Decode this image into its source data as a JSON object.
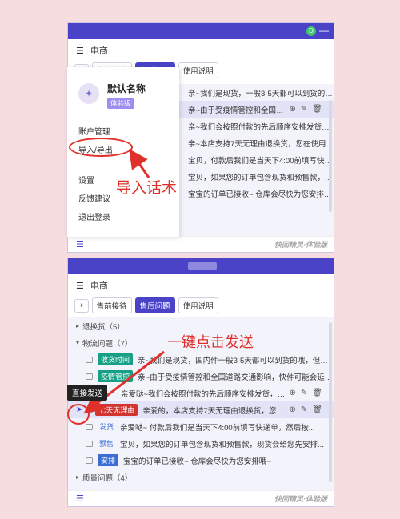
{
  "app": {
    "title": "电商",
    "brand": "快回精灵·体验版",
    "min": "—",
    "logo": "D"
  },
  "panel1": {
    "tabs": [
      "+",
      "售前接待",
      "售后问题",
      "使用说明"
    ],
    "rows": [
      "亲~我们是现货，一般3-5天都可以到货的哦，但是因为...",
      "亲~由于受疫情管控和全国道路交通影响，快件...",
      "亲~我们会按照付款的先后顺序安排发货，一般48小时...",
      "亲~本店支持7天无理由退换货，您在使用中有...",
      "宝贝，付款后我们是当天下4:00前填写快递单，然后按...",
      "宝贝，如果您的订单包含现货和预售款，现货会给您先安排...",
      "宝宝的订单已接收~ 仓库会尽快为您安排哦~"
    ]
  },
  "dropdown": {
    "avatar": "✦",
    "name": "默认名称",
    "badge": "体验版",
    "items": [
      "账户管理",
      "导入/导出",
      "设置",
      "反馈建议",
      "退出登录"
    ]
  },
  "annotations": {
    "import": "导入话术",
    "send": "一键点击发送",
    "tooltip": "直接发送"
  },
  "panel2": {
    "tabs": [
      "+",
      "售前接待",
      "售后问题",
      "使用说明"
    ],
    "cat1": "退换货（5）",
    "cat2": "物流问题（7）",
    "cat3": "质量问题（4）",
    "items": [
      {
        "tag": "收货时间",
        "text": "亲~我们是现货，国内件一般3-5天都可以到货的哦，但是因为..."
      },
      {
        "tag": "疫情管控",
        "text": "亲~由于受疫情管控和全国道路交通影响，快件可能会延迟，..."
      },
      {
        "tag": "",
        "text": "亲爱哒~我们会按照付款的先后顺序安排发货，一般48小时..."
      },
      {
        "tag": "七天无理由",
        "text": "亲爱的，本店支持7天无理由退换货，您..."
      },
      {
        "tag": "发货",
        "text": "亲爱哒~ 付款后我们是当天下4:00前填写快递单，然后按..."
      },
      {
        "tag": "预售",
        "text": "宝贝，如果您的订单包含现货和预售款，现货会给您先安排..."
      },
      {
        "tag": "安排",
        "text": "宝宝的订单已接收~ 仓库会尽快为您安排哦~"
      }
    ]
  },
  "colors": {
    "accent": "#4a43c7",
    "annotation": "#e0302a",
    "background": "#f6dde0"
  }
}
